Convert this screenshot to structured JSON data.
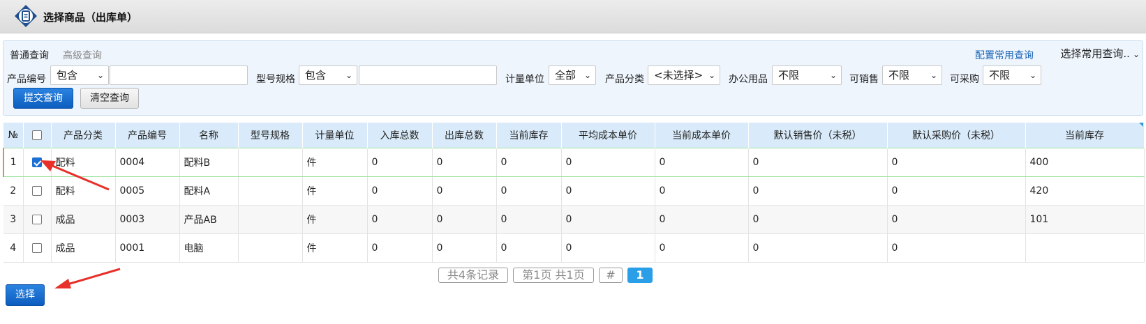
{
  "header": {
    "title": "选择商品（出库单）"
  },
  "query": {
    "tabs": [
      {
        "label": "普通查询"
      },
      {
        "label": "高级查询"
      }
    ],
    "config_link": "配置常用查询",
    "saved_select": "选择常用查询..",
    "fields": {
      "code_label": "产品编号",
      "code_op": "包含",
      "code_value": "",
      "spec_label": "型号规格",
      "spec_op": "包含",
      "spec_value": "",
      "unit_label": "计量单位",
      "unit_value": "全部",
      "category_label": "产品分类",
      "category_value": "<未选择>",
      "office_label": "办公用品",
      "office_value": "不限",
      "sellable_label": "可销售",
      "sellable_value": "不限",
      "purchasable_label": "可采购",
      "purchasable_value": "不限"
    },
    "submit_label": "提交查询",
    "clear_label": "清空查询"
  },
  "grid": {
    "columns": [
      "№",
      "",
      "产品分类",
      "产品编号",
      "名称",
      "型号规格",
      "计量单位",
      "入库总数",
      "出库总数",
      "当前库存",
      "平均成本单价",
      "当前成本单价",
      "默认销售价（未税）",
      "默认采购价（未税）",
      "当前库存"
    ],
    "rows": [
      {
        "n": "1",
        "checked": true,
        "cells": [
          "配料",
          "0004",
          "配料B",
          "",
          "件",
          "0",
          "0",
          "0",
          "0",
          "0",
          "0",
          "0",
          "400"
        ]
      },
      {
        "n": "2",
        "checked": false,
        "cells": [
          "配料",
          "0005",
          "配料A",
          "",
          "件",
          "0",
          "0",
          "0",
          "0",
          "0",
          "0",
          "0",
          "420"
        ]
      },
      {
        "n": "3",
        "checked": false,
        "cells": [
          "成品",
          "0003",
          "产品AB",
          "",
          "件",
          "0",
          "0",
          "0",
          "0",
          "0",
          "0",
          "0",
          "101"
        ]
      },
      {
        "n": "4",
        "checked": false,
        "cells": [
          "成品",
          "0001",
          "电脑",
          "",
          "件",
          "0",
          "0",
          "0",
          "0",
          "0",
          "0",
          "0",
          ""
        ]
      }
    ]
  },
  "pager": {
    "records": "共4条记录",
    "pages": "第1页 共1页",
    "hash": "#",
    "current": "1"
  },
  "select_button": "选择",
  "colors": {
    "primary": "#0c5dbf",
    "header_row": "#d9ebfa",
    "panel": "#eef5fd",
    "link": "#1a63b6",
    "annotation_arrow": "#e8302a"
  }
}
